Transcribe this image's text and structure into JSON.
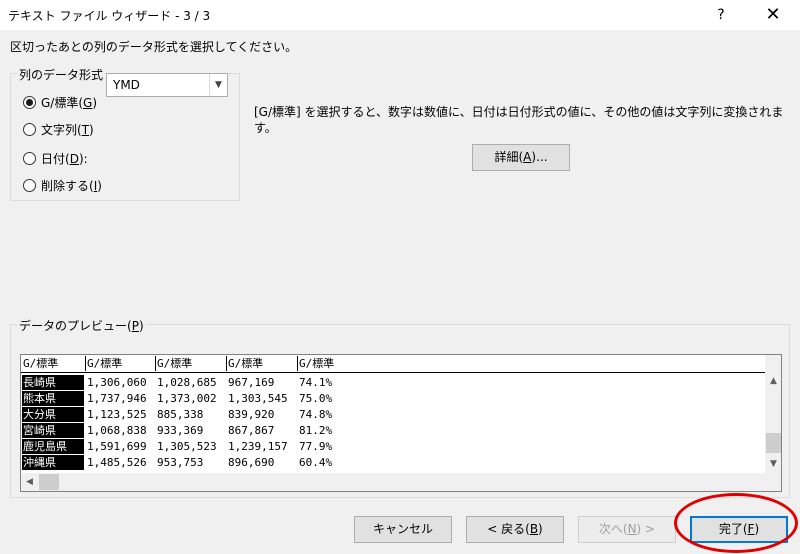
{
  "window": {
    "title": "テキスト ファイル ウィザード - 3 / 3",
    "help": "?",
    "close": "✕"
  },
  "instruction": "区切ったあとの列のデータ形式を選択してください。",
  "column_format": {
    "legend": "列のデータ形式",
    "options": [
      {
        "label_pre": "G/標準(",
        "key": "G",
        "label_post": ")",
        "checked": true
      },
      {
        "label_pre": "文字列(",
        "key": "T",
        "label_post": ")",
        "checked": false
      },
      {
        "label_pre": "日付(",
        "key": "D",
        "label_post": "):",
        "checked": false
      },
      {
        "label_pre": "削除する(",
        "key": "I",
        "label_post": ")",
        "checked": false
      }
    ],
    "date_value": "YMD"
  },
  "description": "[G/標準] を選択すると、数字は数値に、日付は日付形式の値に、その他の値は文字列に変換されます。",
  "details_button": {
    "pre": "詳細(",
    "key": "A",
    "post": ")..."
  },
  "preview": {
    "legend_pre": "データのプレビュー(",
    "legend_key": "P",
    "legend_post": ")",
    "headers": [
      "G/標準",
      "G/標準",
      "G/標準",
      "G/標準",
      "G/標準"
    ],
    "rows": [
      [
        "長崎県",
        "1,306,060",
        "1,028,685",
        "967,169",
        "74.1%"
      ],
      [
        "熊本県",
        "1,737,946",
        "1,373,002",
        "1,303,545",
        "75.0%"
      ],
      [
        "大分県",
        "1,123,525",
        "885,338",
        "839,920",
        "74.8%"
      ],
      [
        "宮崎県",
        "1,068,838",
        "933,369",
        "867,867",
        "81.2%"
      ],
      [
        "鹿児島県",
        "1,591,699",
        "1,305,523",
        "1,239,157",
        "77.9%"
      ],
      [
        "沖縄県",
        "1,485,526",
        "953,753",
        "896,690",
        "60.4%"
      ]
    ]
  },
  "buttons": {
    "cancel": "キャンセル",
    "back": {
      "pre": "< 戻る(",
      "key": "B",
      "post": ")"
    },
    "next": {
      "pre": "次へ(",
      "key": "N",
      "post": ") >"
    },
    "finish": {
      "pre": "完了(",
      "key": "F",
      "post": ")"
    }
  }
}
